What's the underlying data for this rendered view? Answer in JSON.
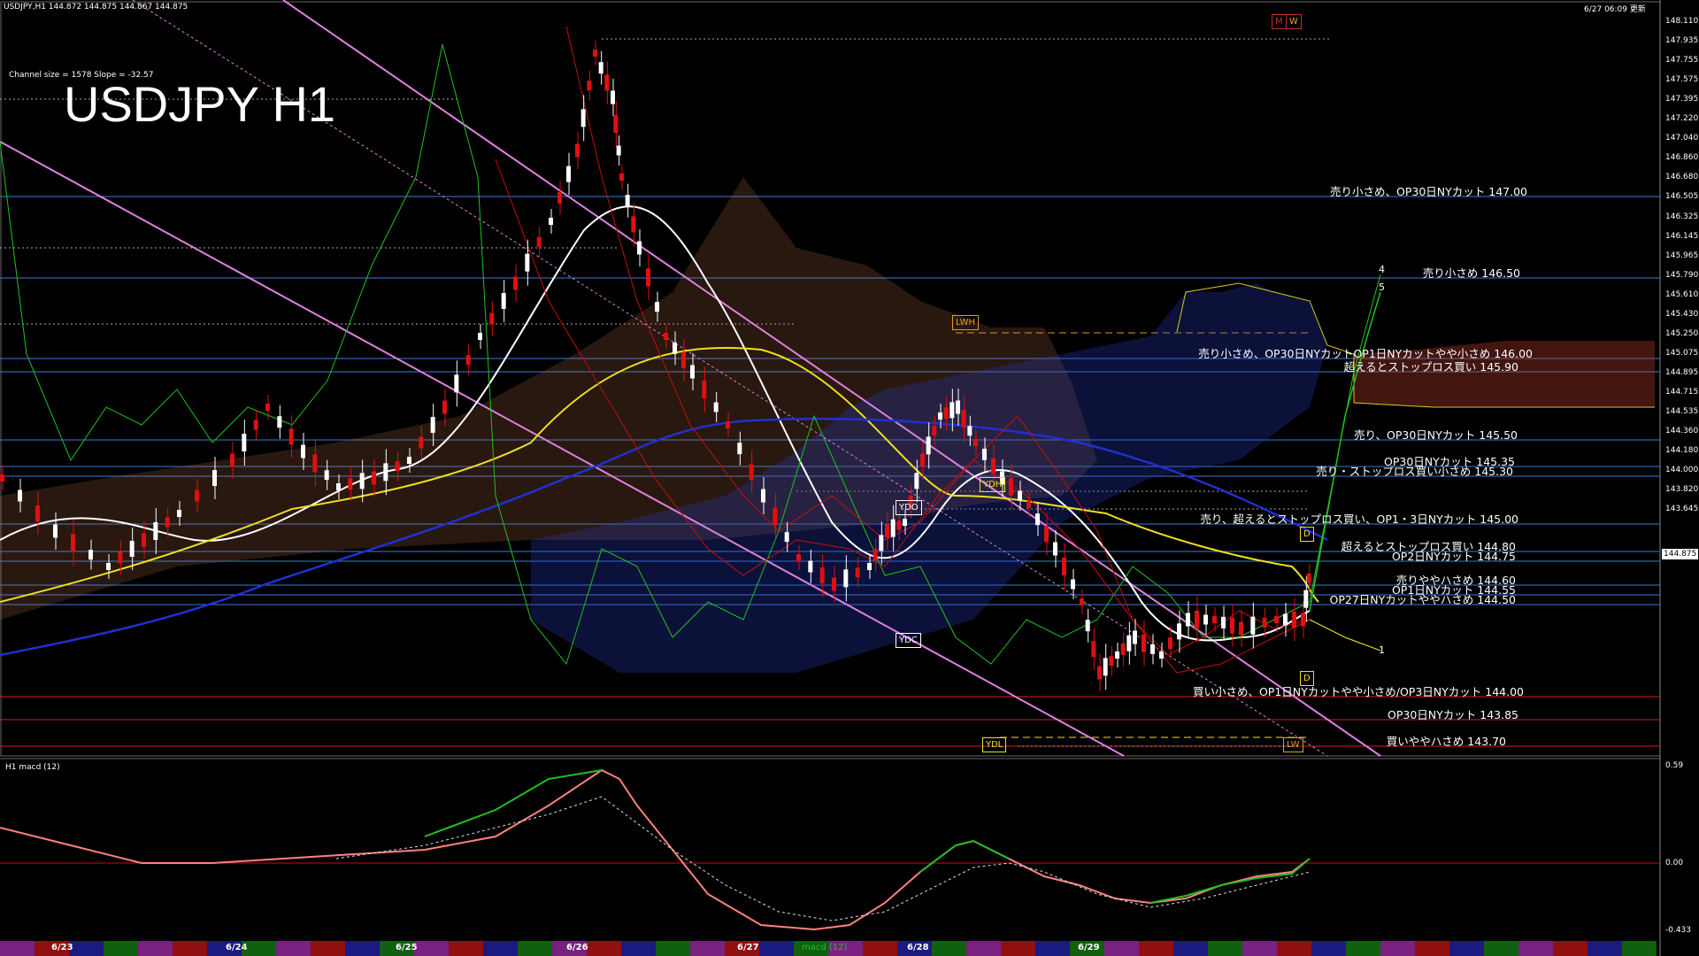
{
  "header": {
    "symbol_info": "USDJPY,H1  144.872 144.875 144.867 144.875",
    "channel_info": "Channel size = 1578 Slope = -32.57",
    "timestamp": "6/27 06:09 更新",
    "title": "USDJPY H1"
  },
  "current_price": "144.875",
  "price_axis": [
    "148.110",
    "147.935",
    "147.755",
    "147.575",
    "147.395",
    "147.220",
    "147.040",
    "146.860",
    "146.680",
    "146.505",
    "146.325",
    "146.145",
    "145.965",
    "145.790",
    "145.610",
    "145.430",
    "145.250",
    "145.075",
    "144.895",
    "144.715",
    "144.535",
    "144.360",
    "144.180",
    "144.000",
    "143.820",
    "143.645"
  ],
  "levels": [
    {
      "text": "売り小さめ、OP30日NYカット 147.00",
      "color": "#3a7bd5"
    },
    {
      "text": "売り小さめ 146.50",
      "color": "#3a7bd5"
    },
    {
      "text": "売り小さめ、OP30日NYカットOP1日NYカットやや小さめ 146.00",
      "color": "#3a7bd5"
    },
    {
      "text": "超えるとストップロス買い 145.90",
      "color": "#3a7bd5"
    },
    {
      "text": "売り、OP30日NYカット 145.50",
      "color": "#3a7bd5"
    },
    {
      "text": "OP30日NYカット 145.35",
      "color": "#3a7bd5"
    },
    {
      "text": "売り・ストップロス買い小さめ 145.30",
      "color": "#3a7bd5"
    },
    {
      "text": "売り、超えるとストップロス買い、OP1・3日NYカット 145.00",
      "color": "#3a7bd5"
    },
    {
      "text": "超えるとストップロス買い 144.80",
      "color": "#3a7bd5"
    },
    {
      "text": "OP2日NYカット 144.75",
      "color": "#3a7bd5"
    },
    {
      "text": "売りややハさめ 144.60",
      "color": "#3a7bd5"
    },
    {
      "text": "OP1日NYカット 144.55",
      "color": "#3a7bd5"
    },
    {
      "text": "OP27日NYカットややハさめ 144.50",
      "color": "#3a7bd5"
    },
    {
      "text": "買い小さめ、OP1日NYカットやや小さめ/OP3日NYカット 144.00",
      "color": "#d02020"
    },
    {
      "text": "OP30日NYカット 143.85",
      "color": "#d02020"
    },
    {
      "text": "買いややハさめ 143.70",
      "color": "#d02020"
    }
  ],
  "tags": {
    "lwh": "LWH",
    "ydo": "YDO",
    "ydc": "YDC",
    "ydh": "YDH",
    "ydl": "YDL",
    "d1": "D",
    "d2": "D",
    "mw_m": "M",
    "mw_w": "W",
    "lw": "LW"
  },
  "proj_labels": {
    "p4": "4",
    "p5": "5",
    "p1": "1"
  },
  "macd": {
    "label": "H1  macd (12)",
    "axis": [
      "0.59",
      "0.00",
      "-0.433"
    ],
    "bar_label": "macd (12)"
  },
  "dates": [
    "6/23",
    "6/24",
    "6/25",
    "6/26",
    "6/27",
    "6/28",
    "6/29"
  ],
  "colors": {
    "candle_up": "#ffffff",
    "candle_down": "#e01010",
    "ma_white": "#ffffff",
    "ma_yellow": "#f0e020",
    "ma_blue": "#2030d0",
    "chikou": "#20c020",
    "channel": "#e080e0",
    "macd_main": "#ff8080"
  }
}
